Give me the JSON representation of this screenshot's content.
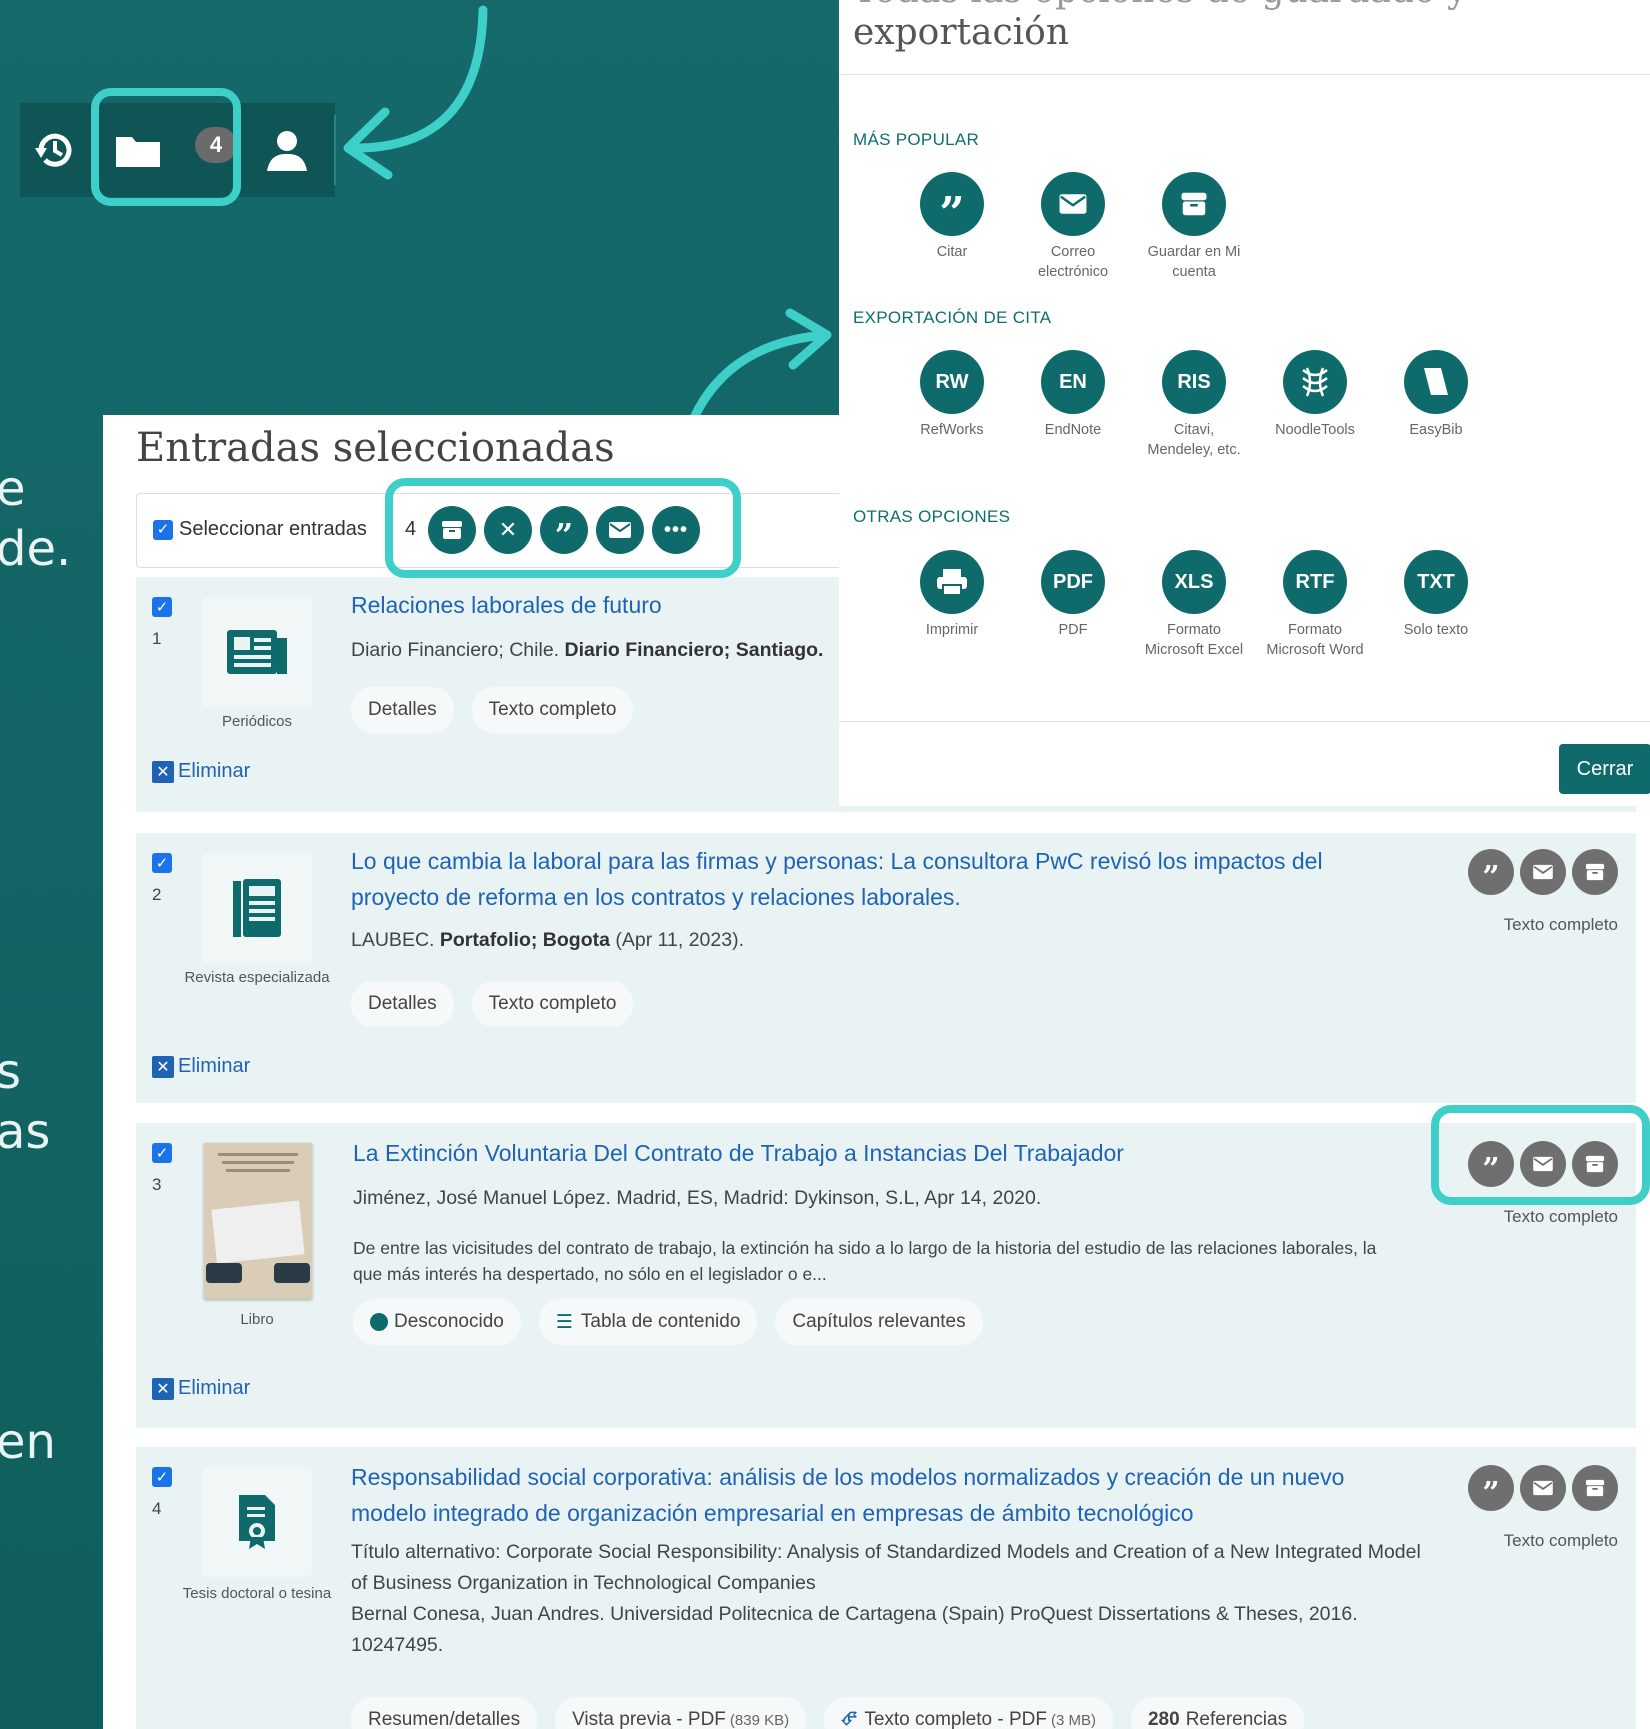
{
  "toolbar": {
    "folder_count": "4"
  },
  "side_fragments": [
    "e",
    "de.",
    "s",
    "as",
    "en"
  ],
  "export": {
    "title_line1": "Todas las opciones de guardado y",
    "title_line2": "exportación",
    "sections": {
      "popular": "MÁS POPULAR",
      "citation": "EXPORTACIÓN DE CITA",
      "other": "OTRAS OPCIONES"
    },
    "popular": [
      {
        "label": "Citar"
      },
      {
        "label": "Correo electrónico"
      },
      {
        "label": "Guardar en Mi cuenta"
      }
    ],
    "citation": [
      {
        "icon": "RW",
        "label": "RefWorks"
      },
      {
        "icon": "EN",
        "label": "EndNote"
      },
      {
        "icon": "RIS",
        "label": "Citavi, Mendeley, etc."
      },
      {
        "icon": "noodletools-icon",
        "label": "NoodleTools"
      },
      {
        "icon": "easybib-icon",
        "label": "EasyBib"
      }
    ],
    "other": [
      {
        "icon": "printer-icon",
        "label": "Imprimir"
      },
      {
        "icon": "PDF",
        "label": "PDF"
      },
      {
        "icon": "XLS",
        "label": "Formato Microsoft Excel"
      },
      {
        "icon": "RTF",
        "label": "Formato Microsoft Word"
      },
      {
        "icon": "TXT",
        "label": "Solo texto"
      }
    ],
    "close_label": "Cerrar"
  },
  "entries": {
    "title": "Entradas seleccionadas",
    "select_label": "Seleccionar entradas",
    "count": "4",
    "records": [
      {
        "num": "1",
        "type": "Periódicos",
        "title": "Relaciones laborales de futuro",
        "meta_plain": "Diario Financiero; Chile.",
        "meta_bold": "Diario Financiero; Santiago.",
        "chips": [
          "Detalles",
          "Texto completo"
        ],
        "delete": "Eliminar"
      },
      {
        "num": "2",
        "type": "Revista especializada",
        "title": "Lo que cambia la laboral para las firmas y personas: La consultora PwC revisó los impactos del proyecto de reforma en los contratos y relaciones laborales.",
        "meta_plain": "LAUBEC.",
        "meta_bold": "Portafolio; Bogota",
        "meta_after": "(Apr 11, 2023).",
        "chips": [
          "Detalles",
          "Texto completo"
        ],
        "fulltext": "Texto completo",
        "delete": "Eliminar"
      },
      {
        "num": "3",
        "type": "Libro",
        "title": "La Extinción Voluntaria Del Contrato de Trabajo a Instancias Del Trabajador",
        "meta_plain": "Jiménez, José Manuel López. Madrid, ES, Madrid: Dykinson, S.L, Apr 14, 2020.",
        "abstract": "De entre las vicisitudes del contrato de trabajo, la extinción ha sido a lo largo de la historia del estudio de las relaciones laborales, la que más interés ha despertado, no sólo en el legislador o e...",
        "chips": [
          "Desconocido",
          "Tabla de contenido",
          "Capítulos relevantes"
        ],
        "fulltext": "Texto completo",
        "delete": "Eliminar"
      },
      {
        "num": "4",
        "type": "Tesis doctoral o tesina",
        "title": "Responsabilidad social corporativa: análisis de los modelos normalizados y creación de un nuevo modelo integrado de organización empresarial en empresas de ámbito tecnológico",
        "alt_title": "Título alternativo: Corporate Social Responsibility: Analysis of Standardized Models and Creation of a New Integrated Model of Business Organization in Technological Companies",
        "meta_plain": "Bernal Conesa, Juan Andres.  Universidad Politecnica de Cartagena (Spain) ProQuest Dissertations & Theses,  2016. 10247495.",
        "chips": [
          "Resumen/detalles",
          "Vista previa - PDF",
          "Texto completo - PDF",
          "Referencias"
        ],
        "chip_sizes": [
          "(839 KB)",
          "(3 MB)"
        ],
        "ref_count": "280",
        "fulltext": "Texto completo"
      }
    ]
  }
}
